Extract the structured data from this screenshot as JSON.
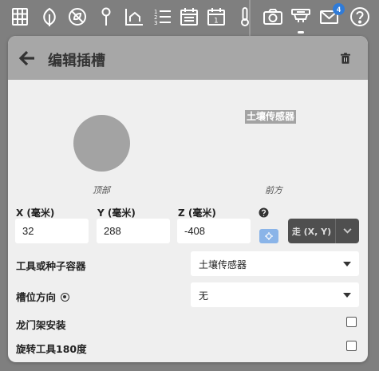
{
  "nav": {
    "icons": [
      "grid-icon",
      "leaf-icon",
      "no-symbol-icon",
      "pin-icon",
      "chart-house-icon",
      "list-numbers-icon",
      "calendar-icon",
      "calendar-day-icon",
      "thermometer-icon",
      "camera-icon",
      "device-icon",
      "mail-icon",
      "help-icon"
    ],
    "calendar_day": "1",
    "mail_badge": "4"
  },
  "panel": {
    "title": "编辑插槽",
    "front_view_label": "土壤传感器",
    "top_caption": "顶部",
    "front_caption": "前方"
  },
  "coords": {
    "x_label": "X (毫米)",
    "y_label": "Y (毫米)",
    "z_label": "Z (毫米)",
    "x_value": "32",
    "y_value": "288",
    "z_value": "-408",
    "go_label": "走 (X, Y)"
  },
  "tool": {
    "label": "工具或种子容器",
    "value": "土壤传感器"
  },
  "direction": {
    "label": "槽位方向",
    "value": "无"
  },
  "gantry": {
    "label": "龙门架安装",
    "checked": false
  },
  "rotate": {
    "label": "旋转工具180度",
    "checked": false
  },
  "colors": {
    "badge": "#2f7bd8",
    "header": "#a7a7a7",
    "locate_button": "#8ab4e8"
  }
}
